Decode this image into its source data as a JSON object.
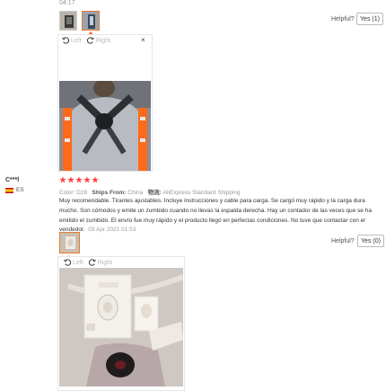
{
  "review_top": {
    "time": "04:17",
    "helpful_label": "Helpful?",
    "yes_label": "Yes (1)",
    "viewer": {
      "left_label": "Left",
      "right_label": "Right",
      "close_label": "×"
    }
  },
  "review": {
    "username": "C***l",
    "country": "ES",
    "rating": 5,
    "color_label": "Color:",
    "color_value": "D28",
    "ships_label": "Ships From:",
    "ships_value": "China",
    "logistics_label": "物流:",
    "logistics_value": "AliExpress Standard Shipping",
    "text": "Muy recomendable. Tirantes ajustables. Incluye instrucciones y cable para carga. Se cargó muy rápido y la carga dura mucho. Son cómodos y emite un zumbido cuando no llevas la espalda derecha. Hay un contador de las veces que se ha emitido el zumbido. El envío fue muy rápido y el producto llegó en perfectas condiciones. No tuve que contactar con el vendedor.",
    "date": "03 Apr 2021 01:53",
    "helpful_label": "Helpful?",
    "yes_label": "Yes (0)",
    "viewer": {
      "left_label": "Left",
      "right_label": "Right"
    }
  },
  "colors": {
    "accent": "#e65c1a",
    "star": "#ff4747",
    "vest": "#ff6a1a"
  }
}
